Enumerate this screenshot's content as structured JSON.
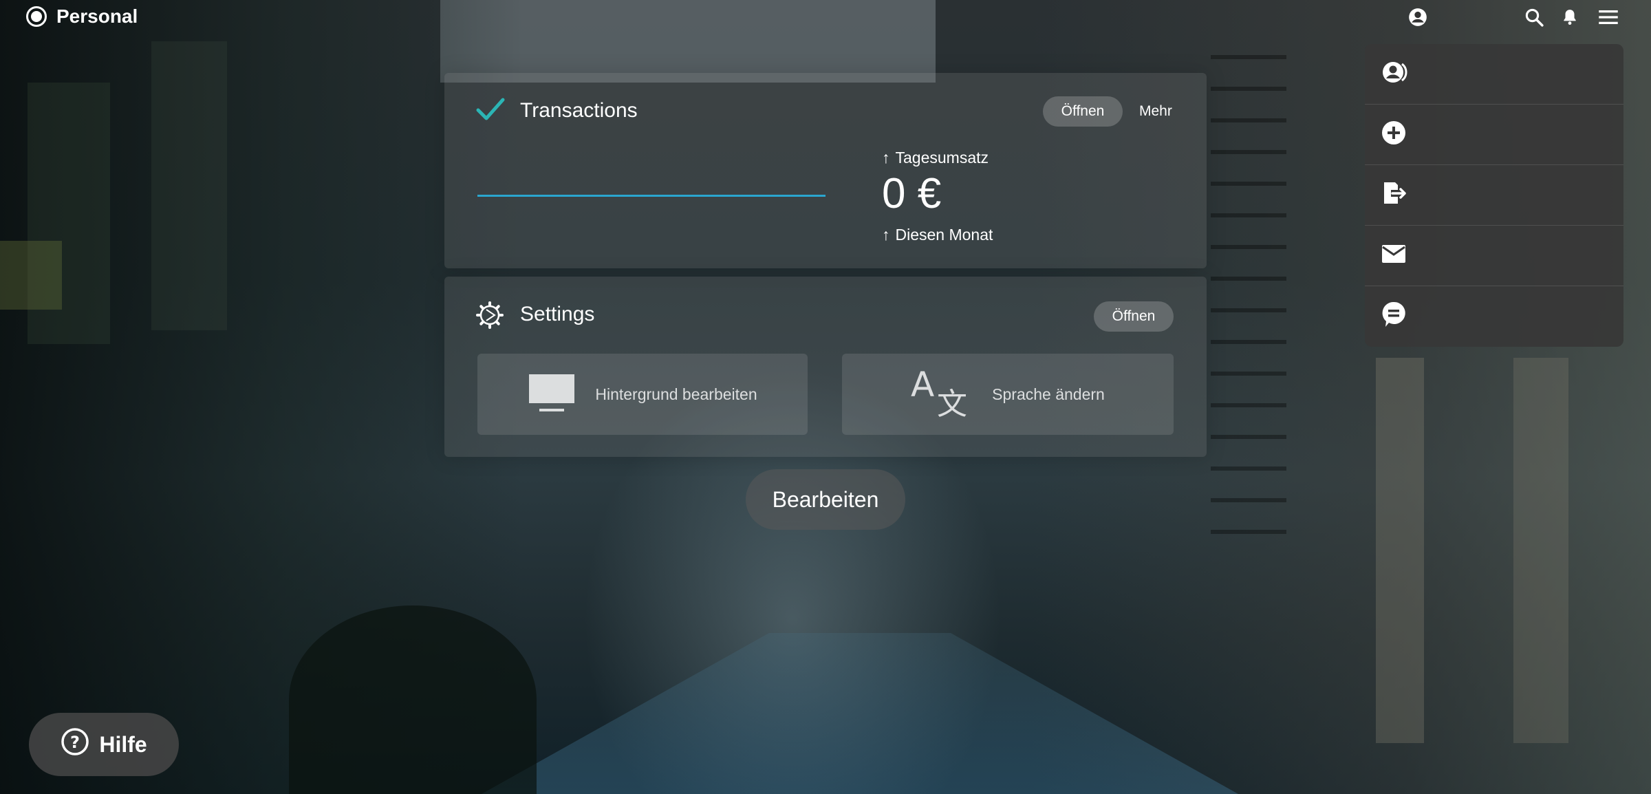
{
  "app": {
    "name": "Personal"
  },
  "header": {
    "icons": [
      "account-icon",
      "search-icon",
      "bell-icon",
      "menu-icon"
    ]
  },
  "transactions": {
    "title": "Transactions",
    "open_label": "Öffnen",
    "more_label": "Mehr",
    "daily_label": "Tagesumsatz",
    "value": "0 €",
    "month_label": "Diesen Monat",
    "accent_color": "#2aa6cf",
    "check_color": "#2bb5b5"
  },
  "settings": {
    "title": "Settings",
    "open_label": "Öffnen",
    "tiles": [
      {
        "label": "Hintergrund bearbeiten",
        "icon": "monitor-icon"
      },
      {
        "label": "Sprache ändern",
        "icon": "translate-icon"
      }
    ]
  },
  "edit": {
    "label": "Bearbeiten"
  },
  "side_menu": {
    "items": [
      "switch-account-icon",
      "add-circle-icon",
      "logout-icon",
      "mail-icon",
      "feedback-icon"
    ]
  },
  "help": {
    "label": "Hilfe"
  }
}
